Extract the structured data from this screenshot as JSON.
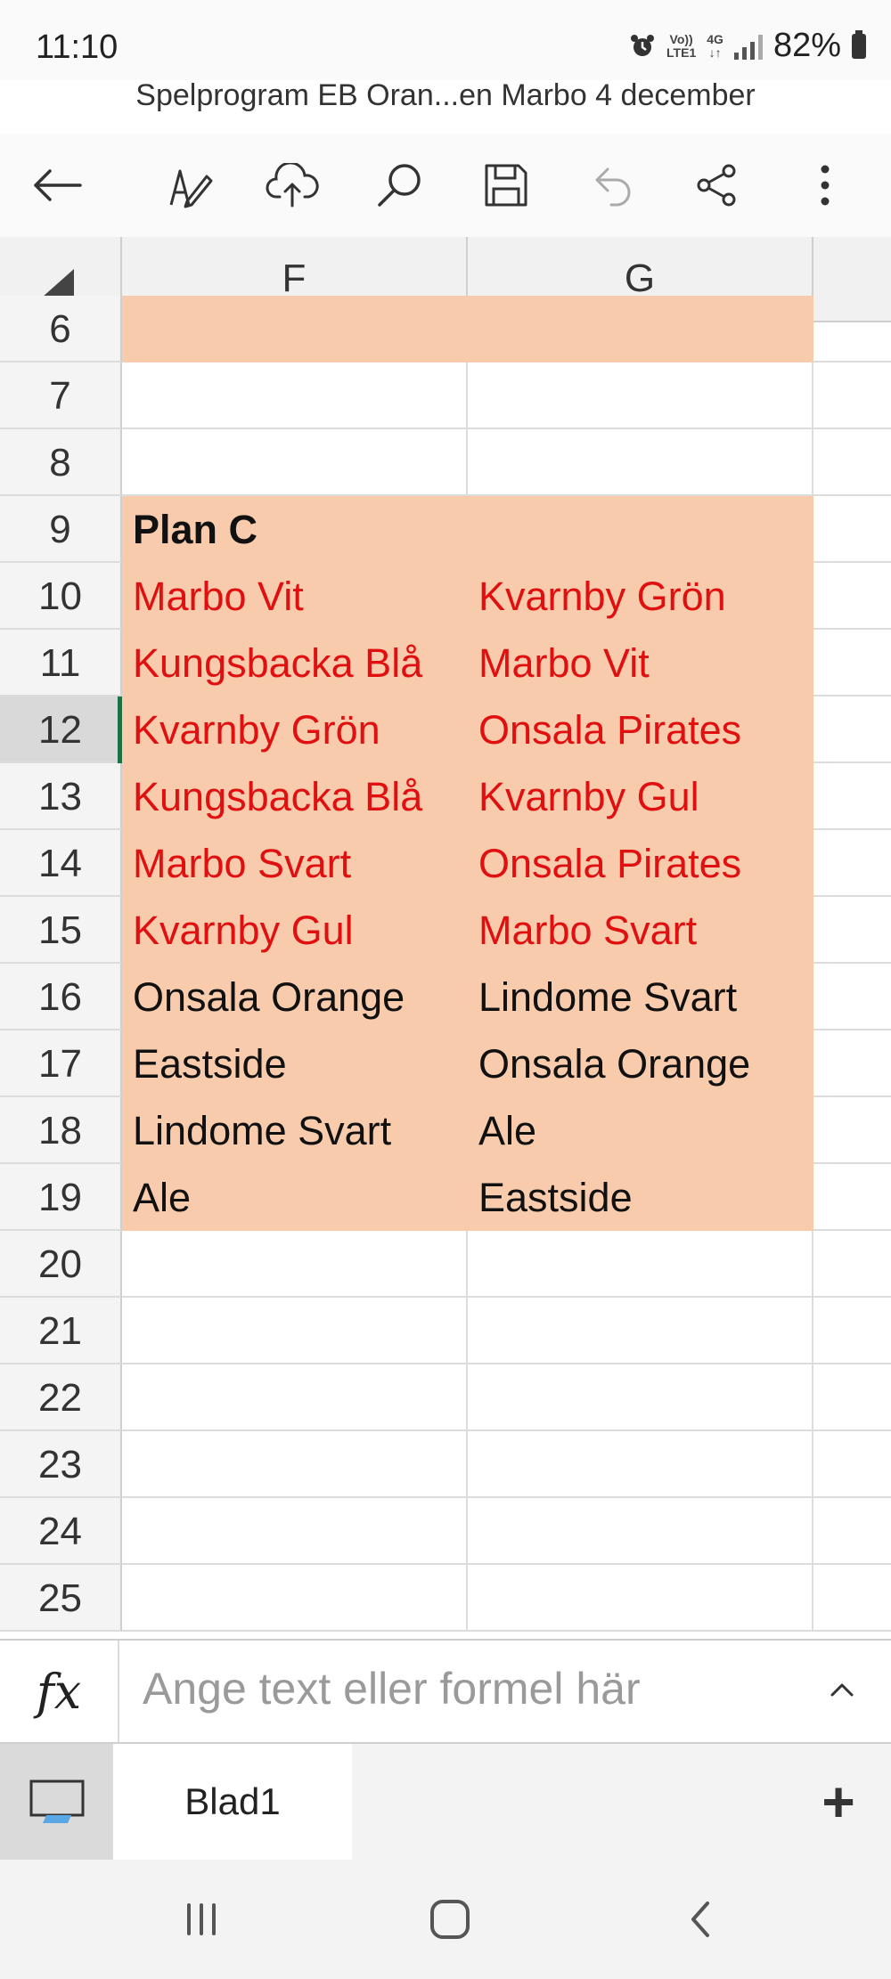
{
  "status_bar": {
    "time": "11:10",
    "alarm_icon": "alarm-icon",
    "volte_line1": "Vo))",
    "volte_line2": "LTE1",
    "network": "4G",
    "battery_percent": "82%"
  },
  "document": {
    "title": "Spelprogram EB Oran...en Marbo 4 december"
  },
  "toolbar": {
    "icons": [
      "back-arrow-icon",
      "edit-pen-icon",
      "cloud-upload-icon",
      "search-icon",
      "save-icon",
      "undo-icon",
      "share-icon",
      "more-vertical-icon"
    ]
  },
  "grid": {
    "columns": [
      "F",
      "G"
    ],
    "rows": [
      {
        "num": "6",
        "f": "",
        "g": "",
        "fill": true
      },
      {
        "num": "7",
        "f": "",
        "g": "",
        "fill": false
      },
      {
        "num": "8",
        "f": "",
        "g": "",
        "fill": false
      },
      {
        "num": "9",
        "f": "Plan C",
        "g": "",
        "fill": true,
        "bold": true
      },
      {
        "num": "10",
        "f": "Marbo Vit",
        "g": "Kvarnby Grön",
        "fill": true,
        "red": true
      },
      {
        "num": "11",
        "f": "Kungsbacka Blå",
        "g": "Marbo Vit",
        "fill": true,
        "red": true
      },
      {
        "num": "12",
        "f": "Kvarnby Grön",
        "g": "Onsala Pirates",
        "fill": true,
        "red": true,
        "active": true
      },
      {
        "num": "13",
        "f": "Kungsbacka Blå",
        "g": "Kvarnby Gul",
        "fill": true,
        "red": true
      },
      {
        "num": "14",
        "f": "Marbo Svart",
        "g": "Onsala Pirates",
        "fill": true,
        "red": true
      },
      {
        "num": "15",
        "f": "Kvarnby Gul",
        "g": "Marbo Svart",
        "fill": true,
        "red": true
      },
      {
        "num": "16",
        "f": "Onsala Orange",
        "g": "Lindome Svart",
        "fill": true
      },
      {
        "num": "17",
        "f": "Eastside",
        "g": "Onsala Orange",
        "fill": true
      },
      {
        "num": "18",
        "f": "Lindome Svart",
        "g": "Ale",
        "fill": true
      },
      {
        "num": "19",
        "f": "Ale",
        "g": "Eastside",
        "fill": true
      },
      {
        "num": "20",
        "f": "",
        "g": "",
        "fill": false
      },
      {
        "num": "21",
        "f": "",
        "g": "",
        "fill": false
      },
      {
        "num": "22",
        "f": "",
        "g": "",
        "fill": false
      },
      {
        "num": "23",
        "f": "",
        "g": "",
        "fill": false
      },
      {
        "num": "24",
        "f": "",
        "g": "",
        "fill": false
      },
      {
        "num": "25",
        "f": "",
        "g": "",
        "fill": false
      }
    ],
    "fill_color": "#f8cbad",
    "red_text_color": "#e01010",
    "active_row_marker_color": "#1e7145"
  },
  "formula_bar": {
    "fx_label": "fx",
    "placeholder": "Ange text eller formel här",
    "value": ""
  },
  "sheets": {
    "tabs": [
      {
        "label": "Blad1"
      }
    ],
    "add_label": "+"
  },
  "nav": {
    "icons": [
      "recent-apps-icon",
      "home-icon",
      "back-icon"
    ]
  }
}
